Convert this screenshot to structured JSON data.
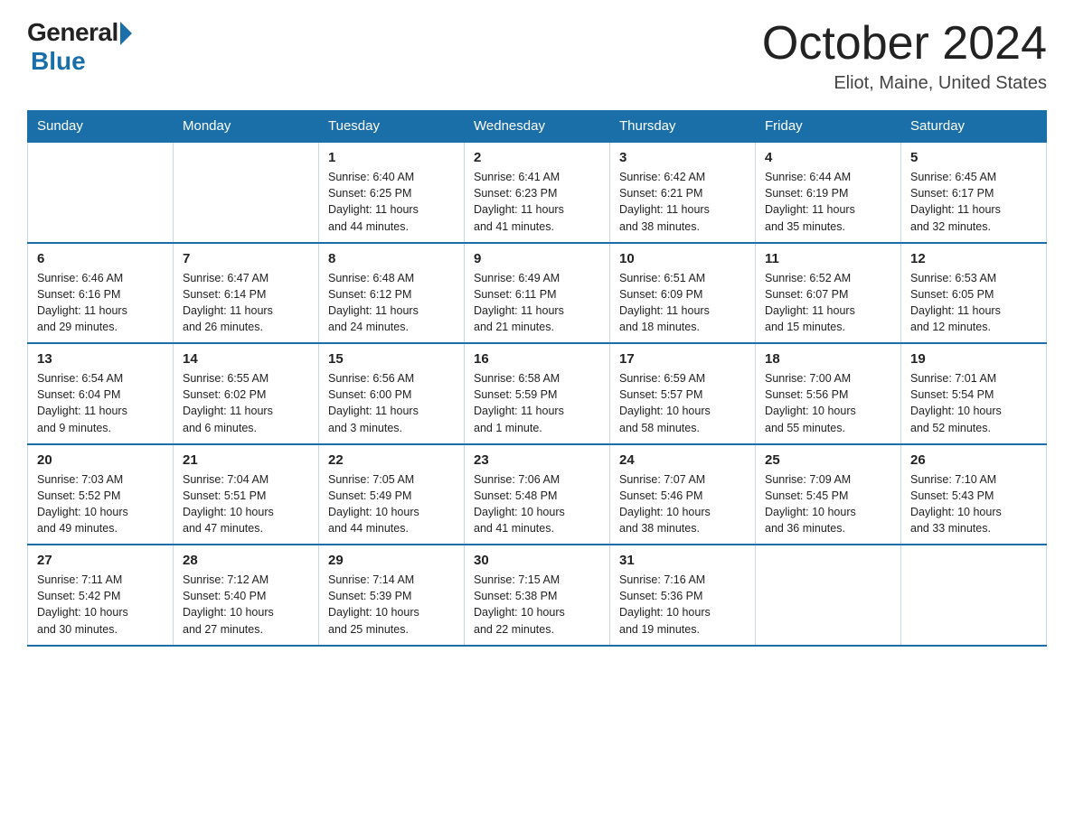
{
  "logo": {
    "general": "General",
    "blue": "Blue"
  },
  "title": {
    "month_year": "October 2024",
    "location": "Eliot, Maine, United States"
  },
  "days_of_week": [
    "Sunday",
    "Monday",
    "Tuesday",
    "Wednesday",
    "Thursday",
    "Friday",
    "Saturday"
  ],
  "weeks": [
    [
      {
        "day": "",
        "details": ""
      },
      {
        "day": "",
        "details": ""
      },
      {
        "day": "1",
        "details": "Sunrise: 6:40 AM\nSunset: 6:25 PM\nDaylight: 11 hours\nand 44 minutes."
      },
      {
        "day": "2",
        "details": "Sunrise: 6:41 AM\nSunset: 6:23 PM\nDaylight: 11 hours\nand 41 minutes."
      },
      {
        "day": "3",
        "details": "Sunrise: 6:42 AM\nSunset: 6:21 PM\nDaylight: 11 hours\nand 38 minutes."
      },
      {
        "day": "4",
        "details": "Sunrise: 6:44 AM\nSunset: 6:19 PM\nDaylight: 11 hours\nand 35 minutes."
      },
      {
        "day": "5",
        "details": "Sunrise: 6:45 AM\nSunset: 6:17 PM\nDaylight: 11 hours\nand 32 minutes."
      }
    ],
    [
      {
        "day": "6",
        "details": "Sunrise: 6:46 AM\nSunset: 6:16 PM\nDaylight: 11 hours\nand 29 minutes."
      },
      {
        "day": "7",
        "details": "Sunrise: 6:47 AM\nSunset: 6:14 PM\nDaylight: 11 hours\nand 26 minutes."
      },
      {
        "day": "8",
        "details": "Sunrise: 6:48 AM\nSunset: 6:12 PM\nDaylight: 11 hours\nand 24 minutes."
      },
      {
        "day": "9",
        "details": "Sunrise: 6:49 AM\nSunset: 6:11 PM\nDaylight: 11 hours\nand 21 minutes."
      },
      {
        "day": "10",
        "details": "Sunrise: 6:51 AM\nSunset: 6:09 PM\nDaylight: 11 hours\nand 18 minutes."
      },
      {
        "day": "11",
        "details": "Sunrise: 6:52 AM\nSunset: 6:07 PM\nDaylight: 11 hours\nand 15 minutes."
      },
      {
        "day": "12",
        "details": "Sunrise: 6:53 AM\nSunset: 6:05 PM\nDaylight: 11 hours\nand 12 minutes."
      }
    ],
    [
      {
        "day": "13",
        "details": "Sunrise: 6:54 AM\nSunset: 6:04 PM\nDaylight: 11 hours\nand 9 minutes."
      },
      {
        "day": "14",
        "details": "Sunrise: 6:55 AM\nSunset: 6:02 PM\nDaylight: 11 hours\nand 6 minutes."
      },
      {
        "day": "15",
        "details": "Sunrise: 6:56 AM\nSunset: 6:00 PM\nDaylight: 11 hours\nand 3 minutes."
      },
      {
        "day": "16",
        "details": "Sunrise: 6:58 AM\nSunset: 5:59 PM\nDaylight: 11 hours\nand 1 minute."
      },
      {
        "day": "17",
        "details": "Sunrise: 6:59 AM\nSunset: 5:57 PM\nDaylight: 10 hours\nand 58 minutes."
      },
      {
        "day": "18",
        "details": "Sunrise: 7:00 AM\nSunset: 5:56 PM\nDaylight: 10 hours\nand 55 minutes."
      },
      {
        "day": "19",
        "details": "Sunrise: 7:01 AM\nSunset: 5:54 PM\nDaylight: 10 hours\nand 52 minutes."
      }
    ],
    [
      {
        "day": "20",
        "details": "Sunrise: 7:03 AM\nSunset: 5:52 PM\nDaylight: 10 hours\nand 49 minutes."
      },
      {
        "day": "21",
        "details": "Sunrise: 7:04 AM\nSunset: 5:51 PM\nDaylight: 10 hours\nand 47 minutes."
      },
      {
        "day": "22",
        "details": "Sunrise: 7:05 AM\nSunset: 5:49 PM\nDaylight: 10 hours\nand 44 minutes."
      },
      {
        "day": "23",
        "details": "Sunrise: 7:06 AM\nSunset: 5:48 PM\nDaylight: 10 hours\nand 41 minutes."
      },
      {
        "day": "24",
        "details": "Sunrise: 7:07 AM\nSunset: 5:46 PM\nDaylight: 10 hours\nand 38 minutes."
      },
      {
        "day": "25",
        "details": "Sunrise: 7:09 AM\nSunset: 5:45 PM\nDaylight: 10 hours\nand 36 minutes."
      },
      {
        "day": "26",
        "details": "Sunrise: 7:10 AM\nSunset: 5:43 PM\nDaylight: 10 hours\nand 33 minutes."
      }
    ],
    [
      {
        "day": "27",
        "details": "Sunrise: 7:11 AM\nSunset: 5:42 PM\nDaylight: 10 hours\nand 30 minutes."
      },
      {
        "day": "28",
        "details": "Sunrise: 7:12 AM\nSunset: 5:40 PM\nDaylight: 10 hours\nand 27 minutes."
      },
      {
        "day": "29",
        "details": "Sunrise: 7:14 AM\nSunset: 5:39 PM\nDaylight: 10 hours\nand 25 minutes."
      },
      {
        "day": "30",
        "details": "Sunrise: 7:15 AM\nSunset: 5:38 PM\nDaylight: 10 hours\nand 22 minutes."
      },
      {
        "day": "31",
        "details": "Sunrise: 7:16 AM\nSunset: 5:36 PM\nDaylight: 10 hours\nand 19 minutes."
      },
      {
        "day": "",
        "details": ""
      },
      {
        "day": "",
        "details": ""
      }
    ]
  ]
}
